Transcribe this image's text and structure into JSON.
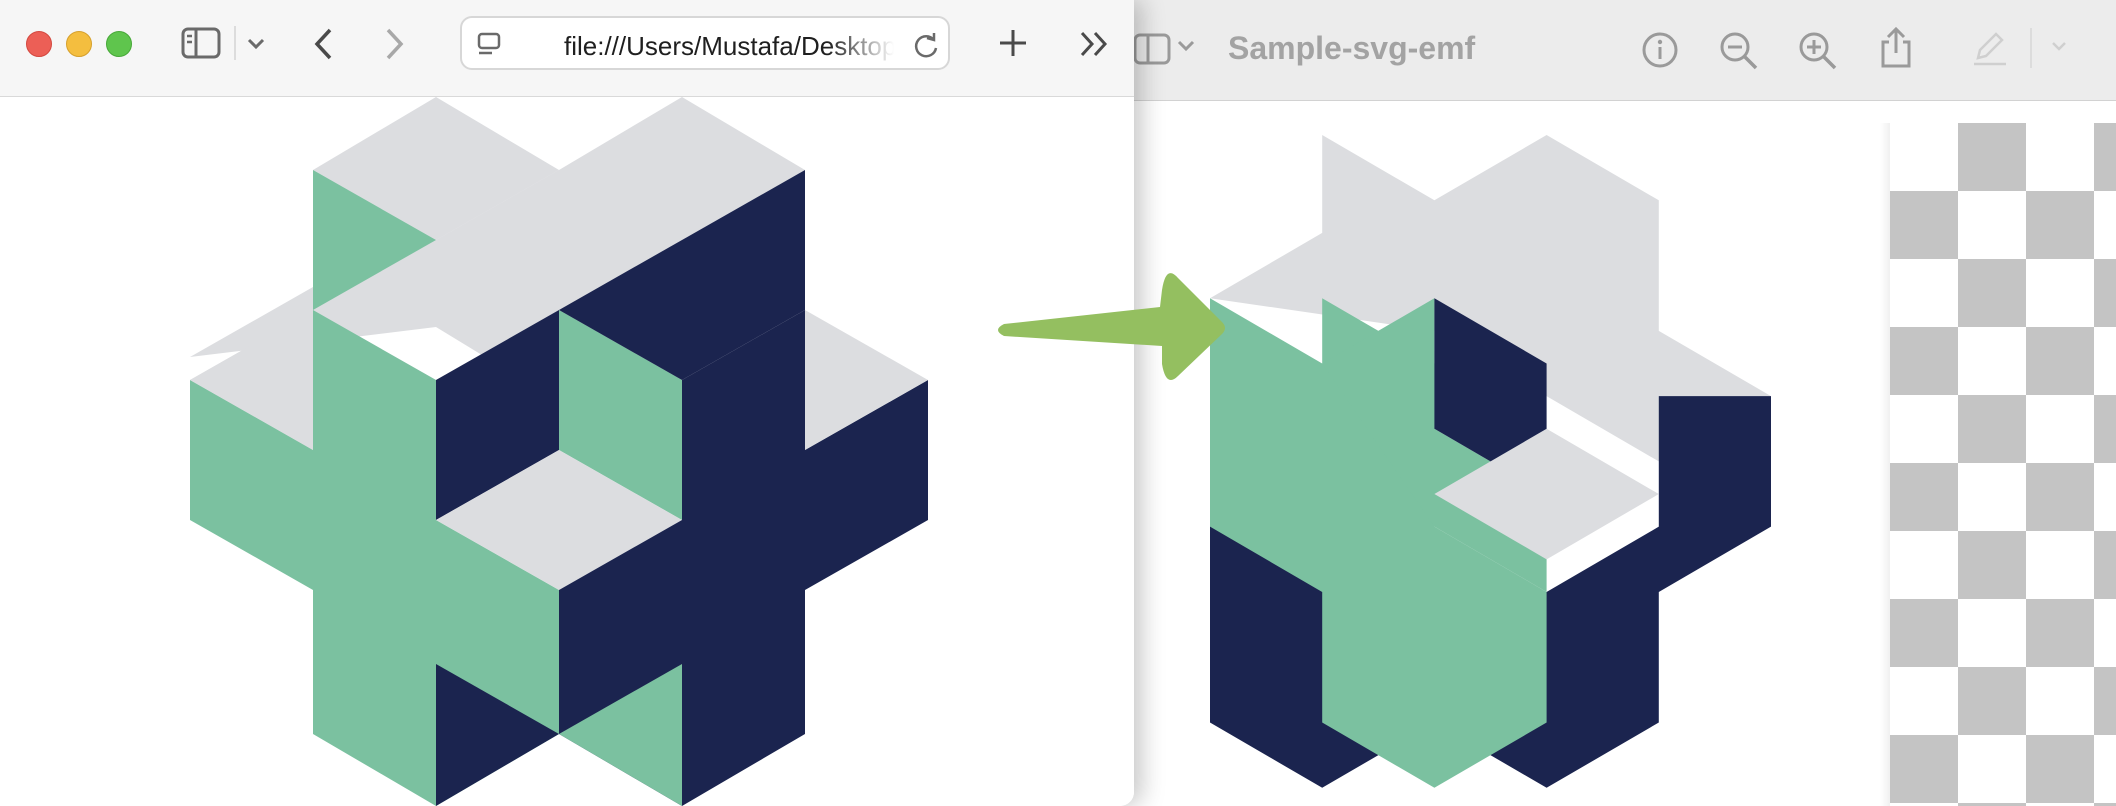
{
  "safari": {
    "url": "file:///Users/Mustafa/Desktop/Sample-svg-emf.svg",
    "icons": {
      "sidebar": "sidebar-icon",
      "sidebar_menu": "chevron-down-icon",
      "back": "chevron-left-icon",
      "forward": "chevron-right-icon",
      "page_menu": "page-menu-icon",
      "reload": "reload-icon",
      "new_tab": "plus-icon",
      "overflow": "double-chevron-right-icon"
    }
  },
  "preview": {
    "title": "Sample-svg-emf",
    "icons": {
      "sidebar": "sidebar-icon",
      "sidebar_menu": "chevron-down-icon",
      "info": "info-icon",
      "zoom_out": "zoom-out-icon",
      "zoom_in": "zoom-in-icon",
      "share": "share-icon",
      "markup": "pencil-icon",
      "markup_menu": "chevron-down-icon"
    }
  },
  "graphic": {
    "colors": {
      "light_gray": "#dcdde0",
      "mint_green": "#7bc1a0",
      "navy": "#1b244f",
      "arrow_green": "#94bf60"
    }
  }
}
